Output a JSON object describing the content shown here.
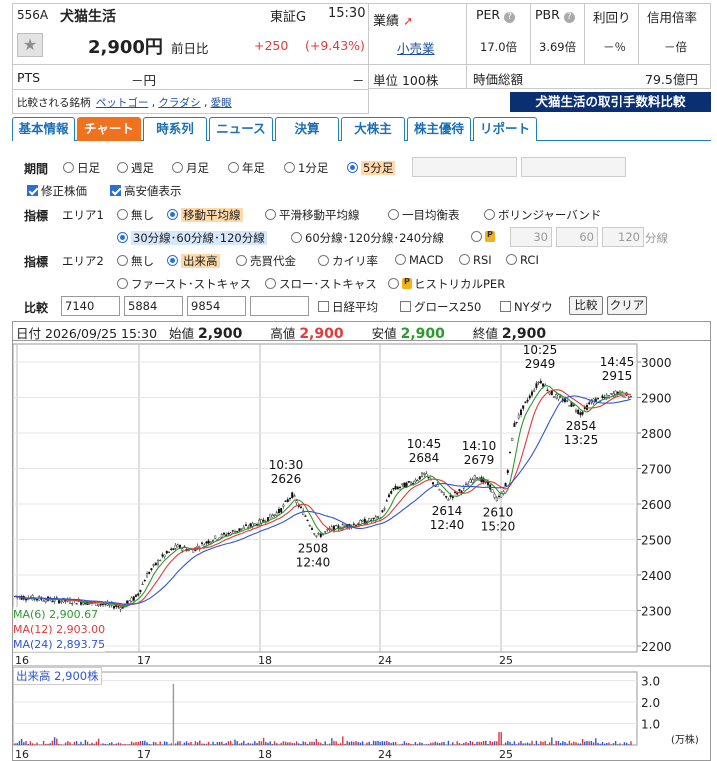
{
  "stock": {
    "code": "556A",
    "name": "犬猫生活",
    "market": "東証G",
    "time": "15:30",
    "price": "2,900円",
    "prev_label": "前日比",
    "change": "+250",
    "change_pct": "(+9.43%)",
    "pts_label": "PTS",
    "pts_value": "－円",
    "pts_change": "－",
    "gyoseki_label": "業績",
    "sector": "小売業",
    "unit": "単位 100株",
    "compare_label": "比較される銘柄",
    "compare_links": [
      "ペットゴー",
      "クラダシ",
      "愛眼"
    ],
    "fee_banner": "犬猫生活の取引手数料比較"
  },
  "ratios": {
    "headers": [
      "PER",
      "PBR",
      "利回り",
      "信用倍率"
    ],
    "values": [
      "17.0倍",
      "3.69倍",
      "－％",
      "－倍"
    ],
    "mcap_label": "時価総額",
    "mcap_value": "79.5億円"
  },
  "tabs": [
    "基本情報",
    "チャート",
    "時系列",
    "ニュース",
    "決算",
    "大株主",
    "株主優待",
    "リポート"
  ],
  "controls": {
    "period_label": "期間",
    "period_opts": [
      "日足",
      "週足",
      "月足",
      "年足",
      "1分足",
      "5分足"
    ],
    "adjust_label": "修正株価",
    "highlow_label": "高安値表示",
    "indicator_label": "指標",
    "area1_label": "エリア1",
    "area1_opts": [
      "無し",
      "移動平均線",
      "平滑移動平均線",
      "一目均衡表",
      "ボリンジャーバンド"
    ],
    "ma_opts": [
      "30分線･60分線･120分線",
      "60分線･120分線･240分線"
    ],
    "ma_custom": [
      "30",
      "60",
      "120"
    ],
    "ma_unit": "分線",
    "area2_label": "エリア2",
    "area2_opts": [
      "無し",
      "出来高",
      "売買代金",
      "カイリ率",
      "MACD",
      "RSI",
      "RCI"
    ],
    "area2_opts2": [
      "ファースト･ストキャス",
      "スロー･ストキャス",
      "ヒストリカルPER"
    ],
    "compare_label": "比較",
    "compare_codes": [
      "7140",
      "5884",
      "9854",
      ""
    ],
    "compare_checks": [
      "日経平均",
      "グロース250",
      "NYダウ"
    ],
    "compare_btn": "比較",
    "clear_btn": "クリア"
  },
  "ohlc": {
    "date_label": "日付",
    "date": "2026/09/25 15:30",
    "open_label": "始値",
    "open": "2,900",
    "high_label": "高値",
    "high": "2,900",
    "low_label": "安値",
    "low": "2,900",
    "close_label": "終値",
    "close": "2,900"
  },
  "chart_data": {
    "type": "line",
    "price_axis": [
      3000,
      2900,
      2800,
      2700,
      2600,
      2500,
      2400,
      2300,
      2200
    ],
    "ylim": [
      2200,
      3000
    ],
    "x_labels": [
      "16",
      "17",
      "18",
      "24",
      "25"
    ],
    "annotations": [
      {
        "time": "10:30",
        "value": "2626"
      },
      {
        "time": "12:40",
        "value": "2508"
      },
      {
        "time": "10:45",
        "value": "2684"
      },
      {
        "time": "12:40",
        "value": "2614"
      },
      {
        "time": "14:10",
        "value": "2679"
      },
      {
        "time": "15:20",
        "value": "2610"
      },
      {
        "time": "10:25",
        "value": "2949"
      },
      {
        "time": "13:25",
        "value": "2854"
      },
      {
        "time": "14:45",
        "value": "2915"
      }
    ],
    "ma_legend": [
      {
        "name": "MA(6)",
        "value": "2,900.67",
        "color": "#2e9a2e"
      },
      {
        "name": "MA(12)",
        "value": "2,903.00",
        "color": "#e23b3b"
      },
      {
        "name": "MA(24)",
        "value": "2,893.75",
        "color": "#2f55d4"
      }
    ],
    "volume": {
      "label": "出来高",
      "value": "2,900株",
      "axis": [
        3.0,
        2.0,
        1.0
      ],
      "unit": "(万株)"
    }
  }
}
